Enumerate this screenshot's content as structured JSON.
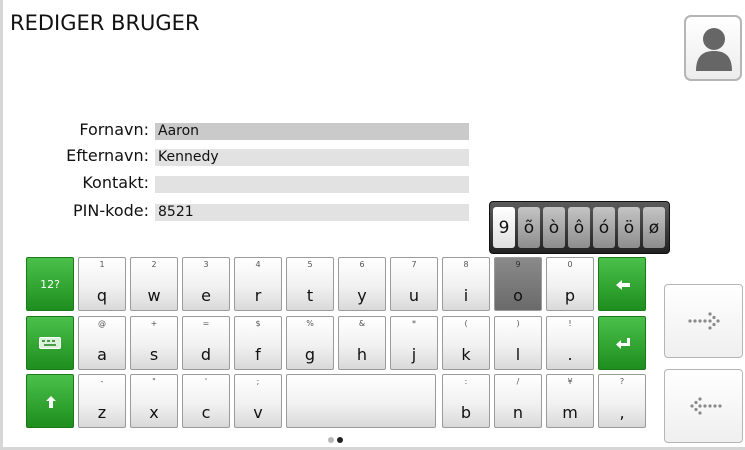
{
  "header": {
    "title": "REDIGER BRUGER"
  },
  "form": {
    "fields": [
      {
        "label": "Fornavn:",
        "value": "Aaron"
      },
      {
        "label": "Efternavn:",
        "value": "Kennedy"
      },
      {
        "label": "Kontakt:",
        "value": ""
      },
      {
        "label": "PIN-kode:",
        "value": "8521"
      }
    ]
  },
  "accent_popup": {
    "keys": [
      "9",
      "õ",
      "ò",
      "ô",
      "ó",
      "ö",
      "ø"
    ],
    "selected": "9"
  },
  "keyboard": {
    "mode_key_label": "12?",
    "rows": [
      [
        {
          "sec": "1",
          "pri": "q"
        },
        {
          "sec": "2",
          "pri": "w"
        },
        {
          "sec": "3",
          "pri": "e"
        },
        {
          "sec": "4",
          "pri": "r"
        },
        {
          "sec": "5",
          "pri": "t"
        },
        {
          "sec": "6",
          "pri": "y"
        },
        {
          "sec": "7",
          "pri": "u"
        },
        {
          "sec": "8",
          "pri": "i"
        },
        {
          "sec": "9",
          "pri": "o"
        },
        {
          "sec": "0",
          "pri": "p"
        }
      ],
      [
        {
          "sec": "@",
          "pri": "a"
        },
        {
          "sec": "+",
          "pri": "s"
        },
        {
          "sec": "=",
          "pri": "d"
        },
        {
          "sec": "$",
          "pri": "f"
        },
        {
          "sec": "%",
          "pri": "g"
        },
        {
          "sec": "&",
          "pri": "h"
        },
        {
          "sec": "*",
          "pri": "j"
        },
        {
          "sec": "(",
          "pri": "k"
        },
        {
          "sec": ")",
          "pri": "l"
        },
        {
          "sec": "!",
          "pri": "."
        }
      ],
      [
        {
          "sec": "-",
          "pri": "z"
        },
        {
          "sec": "\"",
          "pri": "x"
        },
        {
          "sec": "'",
          "pri": "c"
        },
        {
          "sec": ";",
          "pri": "v"
        },
        {
          "sec": ":",
          "pri": "b"
        },
        {
          "sec": "/",
          "pri": "n"
        },
        {
          "sec": "¥",
          "pri": "m"
        },
        {
          "sec": "?",
          "pri": ","
        }
      ]
    ],
    "pressed_key": "o"
  },
  "pager": {
    "pages": 2,
    "active": 2
  },
  "icons": {
    "avatar": "user-silhouette-icon",
    "backspace": "backspace-arrow-icon",
    "enter": "enter-icon",
    "keyboard": "keyboard-icon",
    "shift": "shift-arrow-icon",
    "next": "dotted-arrow-right-icon",
    "prev": "dotted-arrow-left-icon"
  },
  "colors": {
    "green_key": "#2aa52a",
    "field_bg": "#e2e2e2"
  }
}
